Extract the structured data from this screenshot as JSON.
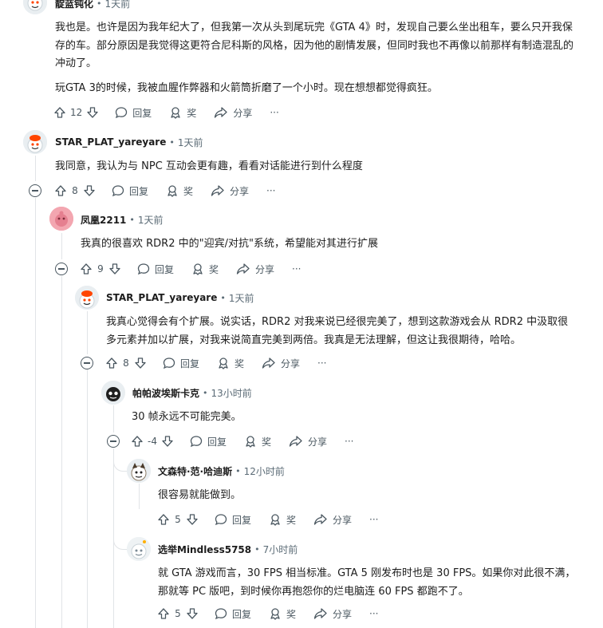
{
  "comments": [
    {
      "author": "靛蓝钝化",
      "time": "1天前",
      "body": "我也是。也许是因为我年纪大了，但我第一次从头到尾玩完《GTA 4》时，发现自己要么坐出租车，要么只开我保存的车。部分原因是我觉得这更符合尼科斯的风格，因为他的剧情发展，但同时我也不再像以前那样有制造混乱的冲动了。",
      "body2": "玩GTA 3的时候，我被血腥作弊器和火箭筒折磨了一个小时。现在想想都觉得疯狂。",
      "votes": "12",
      "reply": "回复",
      "award": "奖",
      "share": "分享",
      "more": "···"
    },
    {
      "author": "STAR_PLAT_yareyare",
      "time": "1天前",
      "body": "我同意，我认为与 NPC 互动会更有趣，看看对话能进行到什么程度",
      "votes": "8",
      "reply": "回复",
      "award": "奖",
      "share": "分享",
      "more": "···"
    },
    {
      "author": "凤凰2211",
      "time": "1天前",
      "body": "我真的很喜欢 RDR2 中的\"迎宾/对抗\"系统，希望能对其进行扩展",
      "votes": "9",
      "reply": "回复",
      "award": "奖",
      "share": "分享",
      "more": "···"
    },
    {
      "author": "STAR_PLAT_yareyare",
      "time": "1天前",
      "body": "我真心觉得会有个扩展。说实话，RDR2 对我来说已经很完美了，想到这款游戏会从 RDR2 中汲取很多元素并加以扩展，对我来说简直完美到两倍。我真是无法理解，但这让我很期待，哈哈。",
      "votes": "8",
      "reply": "回复",
      "award": "奖",
      "share": "分享",
      "more": "···"
    },
    {
      "author": "帕帕波埃斯卡克",
      "time": "13小时前",
      "body": "30 帧永远不可能完美。",
      "votes": "-4",
      "reply": "回复",
      "award": "奖",
      "share": "分享",
      "more": "···"
    },
    {
      "author": "文森特·范·哈迪斯",
      "time": "12小时前",
      "body": "很容易就能做到。",
      "votes": "5",
      "reply": "回复",
      "award": "奖",
      "share": "分享",
      "more": "···"
    },
    {
      "author": "选举Mindless5758",
      "time": "7小时前",
      "body": "就 GTA 游戏而言，30 FPS 相当标准。GTA 5 刚发布时也是 30 FPS。如果你对此很不满，那就等 PC 版吧，到时候你再抱怨你的烂电脑连 60 FPS 都跑不了。",
      "votes": "5",
      "reply": "回复",
      "award": "奖",
      "share": "分享",
      "more": "···"
    }
  ],
  "colors": {
    "accent": "#0045ac",
    "muted": "#5b6b76",
    "line": "#e1e4e7",
    "text": "#1c1c1c"
  }
}
